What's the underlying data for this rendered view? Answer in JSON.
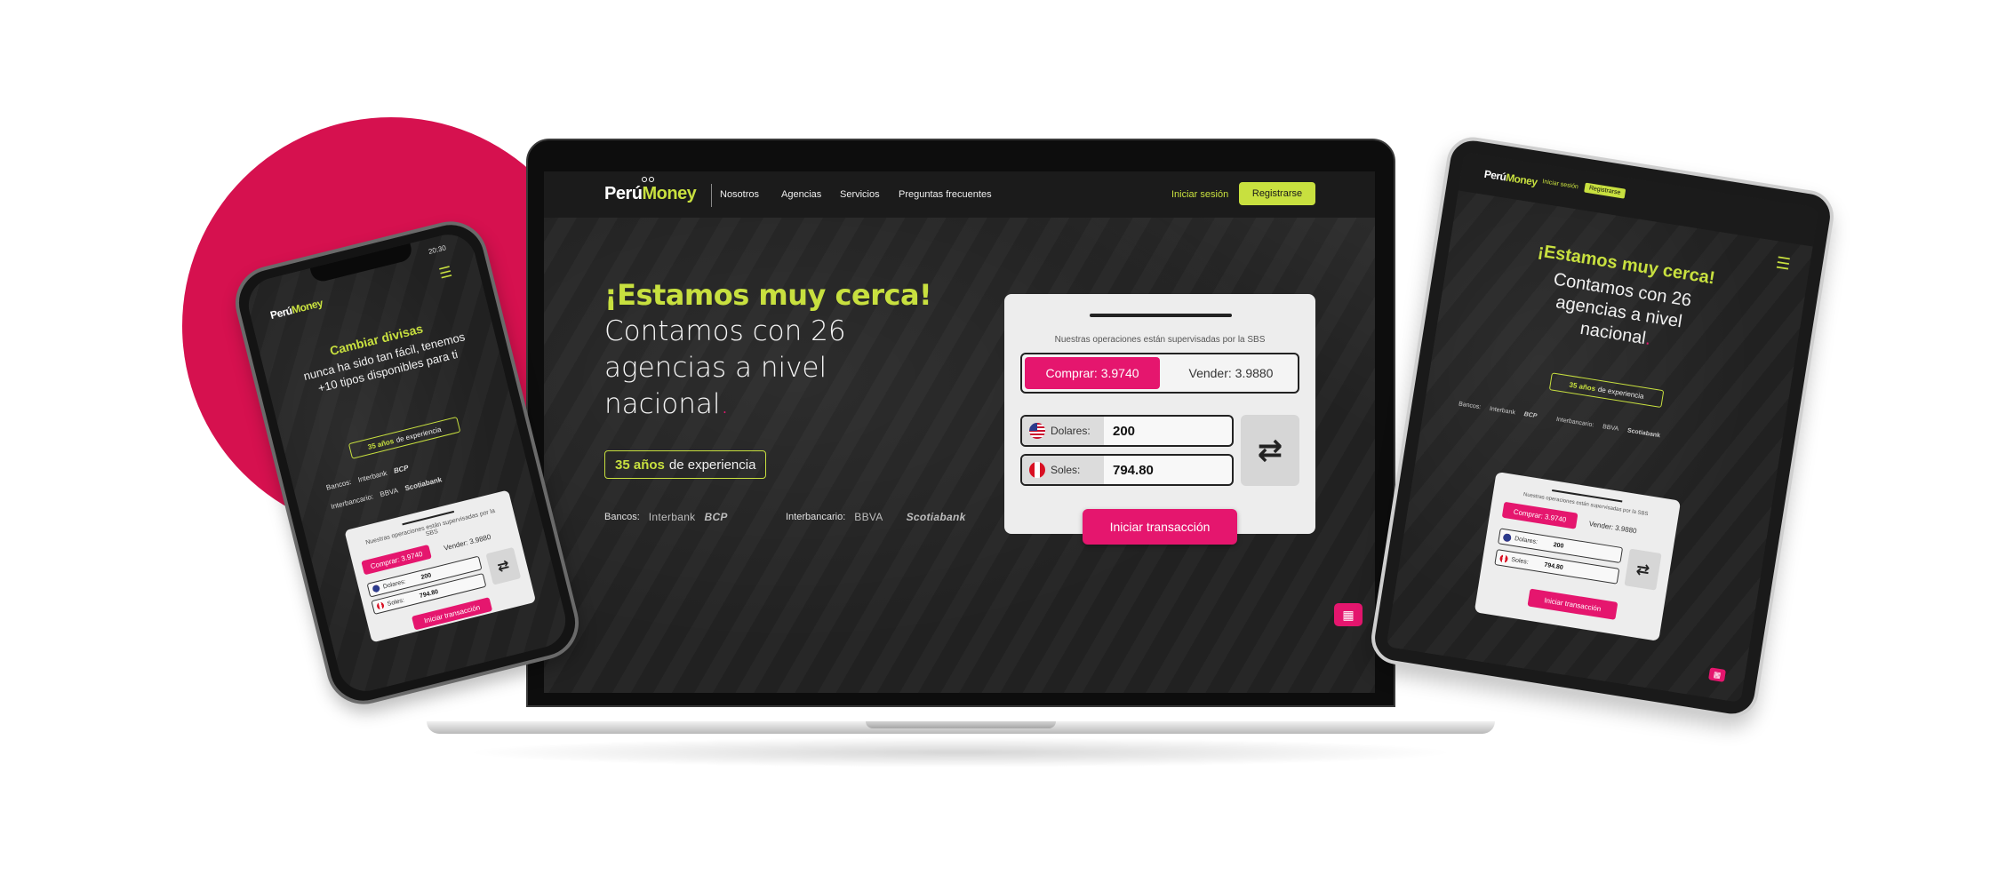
{
  "brand": {
    "logo_white": "Perú",
    "logo_green": "Money"
  },
  "nav": {
    "links": [
      "Nosotros",
      "Agencias",
      "Servicios",
      "Preguntas frecuentes"
    ],
    "login_label": "Iniciar sesión",
    "register_label": "Registrarse"
  },
  "hero": {
    "headline_green": "¡Estamos muy cerca!",
    "headline_white": "Contamos con 26 agencias a nivel nacional",
    "headline_dot": ".",
    "experience_years": "35 años",
    "experience_rest": "de experiencia"
  },
  "banks": {
    "banks_label": "Bancos:",
    "banks": [
      "Interbank",
      "BCP"
    ],
    "interbank_label": "Interbancario:",
    "interbank_banks": [
      "BBVA",
      "Scotiabank"
    ]
  },
  "exchange": {
    "note": "Nuestras operaciones están supervisadas por la SBS",
    "buy_label": "Comprar: 3.9740",
    "sell_label": "Vender: 3.9880",
    "usd_label": "Dolares:",
    "usd_value": "200",
    "pen_label": "Soles:",
    "pen_value": "794.80",
    "swap_icon": "⇄",
    "cta_label": "Iniciar transacción"
  },
  "phone": {
    "time": "20:30",
    "headline_green": "Cambiar divisas",
    "headline_white": "nunca ha sido tan fácil, tenemos +10 tipos disponibles para ti",
    "note": "Nuestras operaciones están supervisadas por la SBS"
  },
  "colors": {
    "accent_green": "#c8e03f",
    "accent_pink": "#e5166e",
    "circle_pink": "#d6114f",
    "screen_dark": "#222222"
  },
  "icons": {
    "menu": "hamburger-menu-icon",
    "swap": "swap-arrows-icon",
    "calculator": "calculator-icon",
    "flag_us": "us-flag-icon",
    "flag_pe": "peru-flag-icon"
  }
}
